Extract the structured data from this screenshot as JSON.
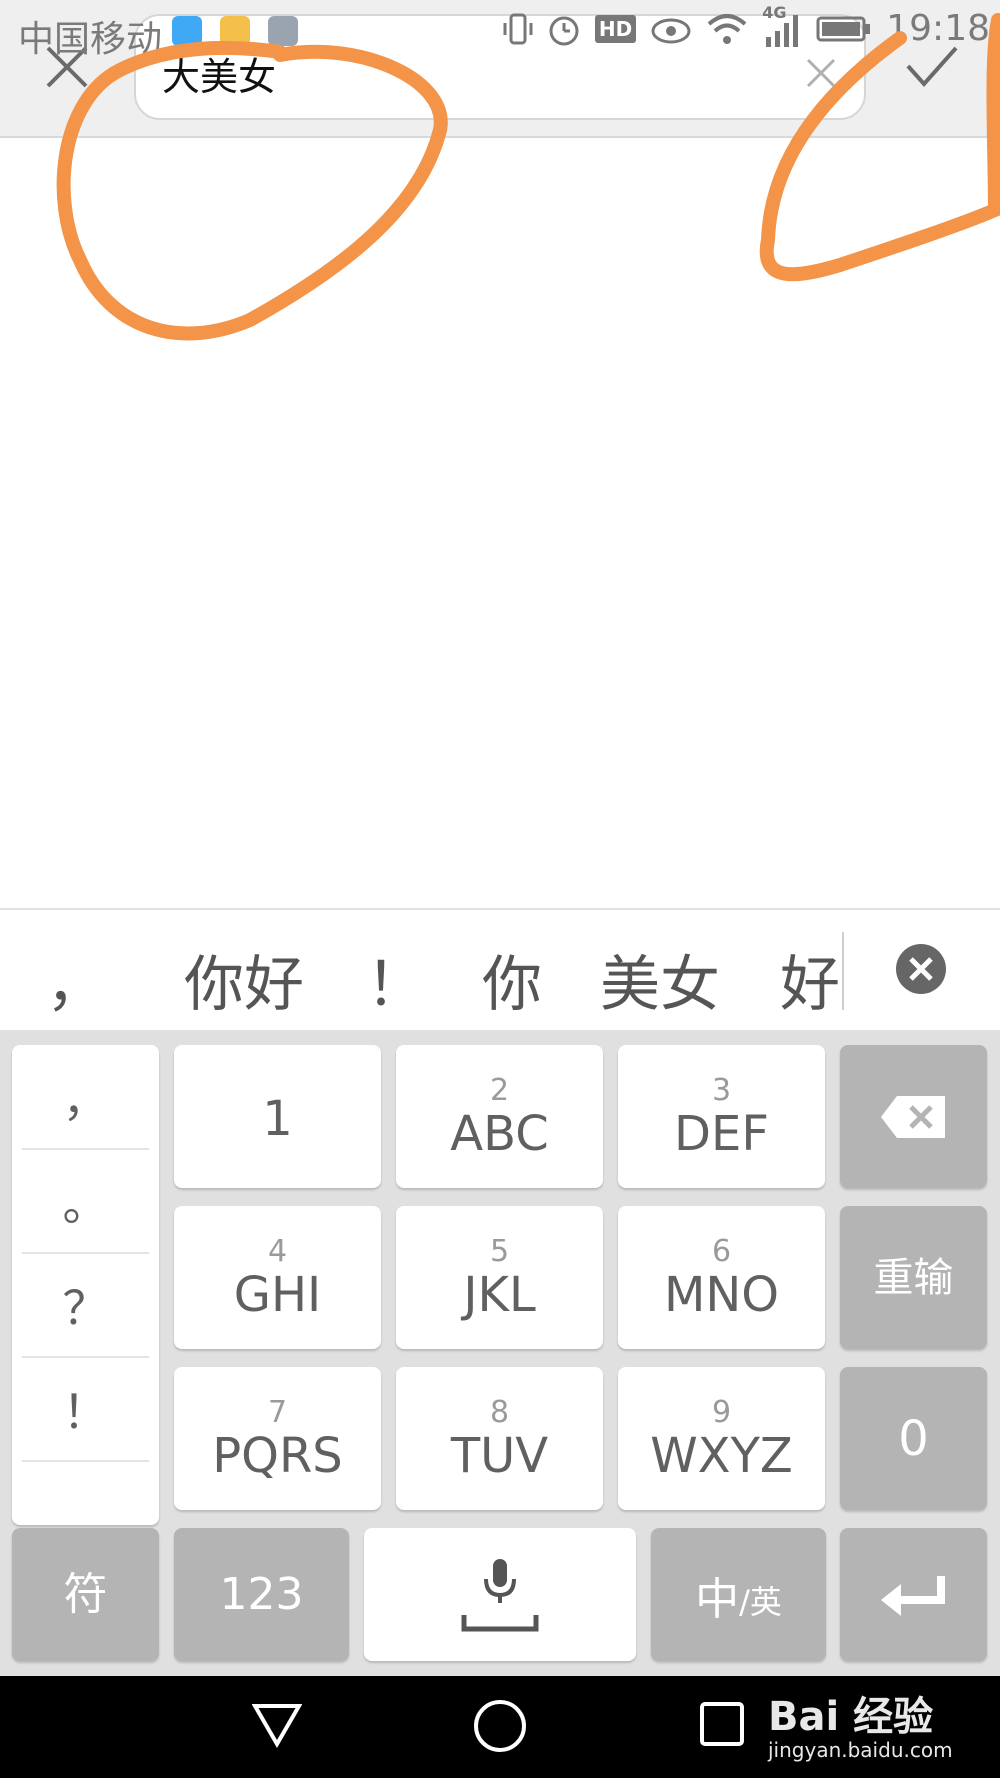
{
  "status_bar": {
    "carrier": "中国移动",
    "network": "4G",
    "hd_label": "HD",
    "time": "19:18"
  },
  "topbar": {
    "search_value": "大美女",
    "icons": {
      "close": "close-icon",
      "confirm": "check-icon",
      "clear": "clear-x-icon"
    }
  },
  "candidates": {
    "items": [
      "，",
      "你好",
      "！",
      "你",
      "美女",
      "好"
    ]
  },
  "keyboard": {
    "punctuation": [
      "，",
      "。",
      "？",
      "！"
    ],
    "keys": [
      {
        "num": "",
        "label": "1"
      },
      {
        "num": "2",
        "label": "ABC"
      },
      {
        "num": "3",
        "label": "DEF"
      },
      {
        "num": "4",
        "label": "GHI"
      },
      {
        "num": "5",
        "label": "JKL"
      },
      {
        "num": "6",
        "label": "MNO"
      },
      {
        "num": "7",
        "label": "PQRS"
      },
      {
        "num": "8",
        "label": "TUV"
      },
      {
        "num": "9",
        "label": "WXYZ"
      }
    ],
    "side": {
      "reinput": "重输",
      "zero": "0"
    },
    "bottom": {
      "symbols": "符",
      "numbers": "123",
      "lang_main": "中",
      "lang_sub": "/英"
    }
  },
  "watermark": {
    "logo": "Bai  经验",
    "url": "jingyan.baidu.com"
  },
  "colors": {
    "annotation": "#f39448",
    "keyboard_bg": "#e0e0e0",
    "gray_key": "#b4b4b4"
  }
}
